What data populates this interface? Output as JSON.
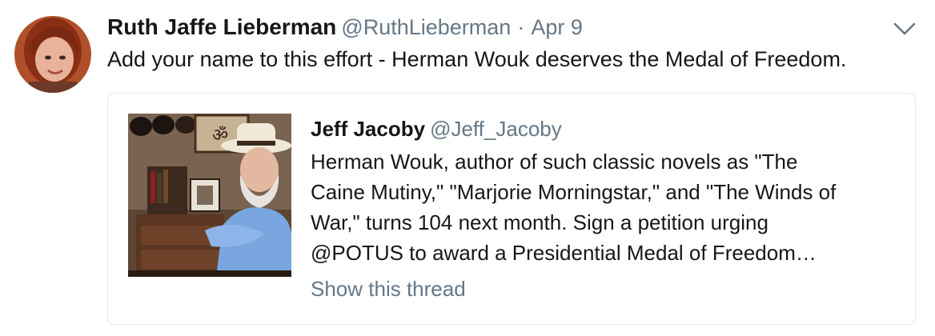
{
  "tweet": {
    "author_name": "Ruth Jaffe Lieberman",
    "author_handle": "@RuthLieberman",
    "separator": "·",
    "date": "Apr 9",
    "text": "Add your name to this effort - Herman Wouk deserves the Medal of Freedom.",
    "avatar_icon": "avatar-photo",
    "menu_icon": "chevron-down-icon"
  },
  "quoted_tweet": {
    "author_name": "Jeff Jacoby",
    "author_handle": "@Jeff_Jacoby",
    "text_lines": [
      "Herman Wouk, author of such classic novels as \"The",
      "Caine Mutiny,\" \"Marjorie Morningstar,\" and \"The Winds of",
      "War,\" turns 104 next month. Sign a petition urging",
      "@POTUS to award a Presidential Medal of Freedom…"
    ],
    "media_icon": "photo-thumbnail",
    "show_thread_label": "Show this thread"
  },
  "colors": {
    "primary_text": "#14171a",
    "secondary_text": "#657786",
    "border": "#e1e8ed",
    "background": "#ffffff"
  }
}
